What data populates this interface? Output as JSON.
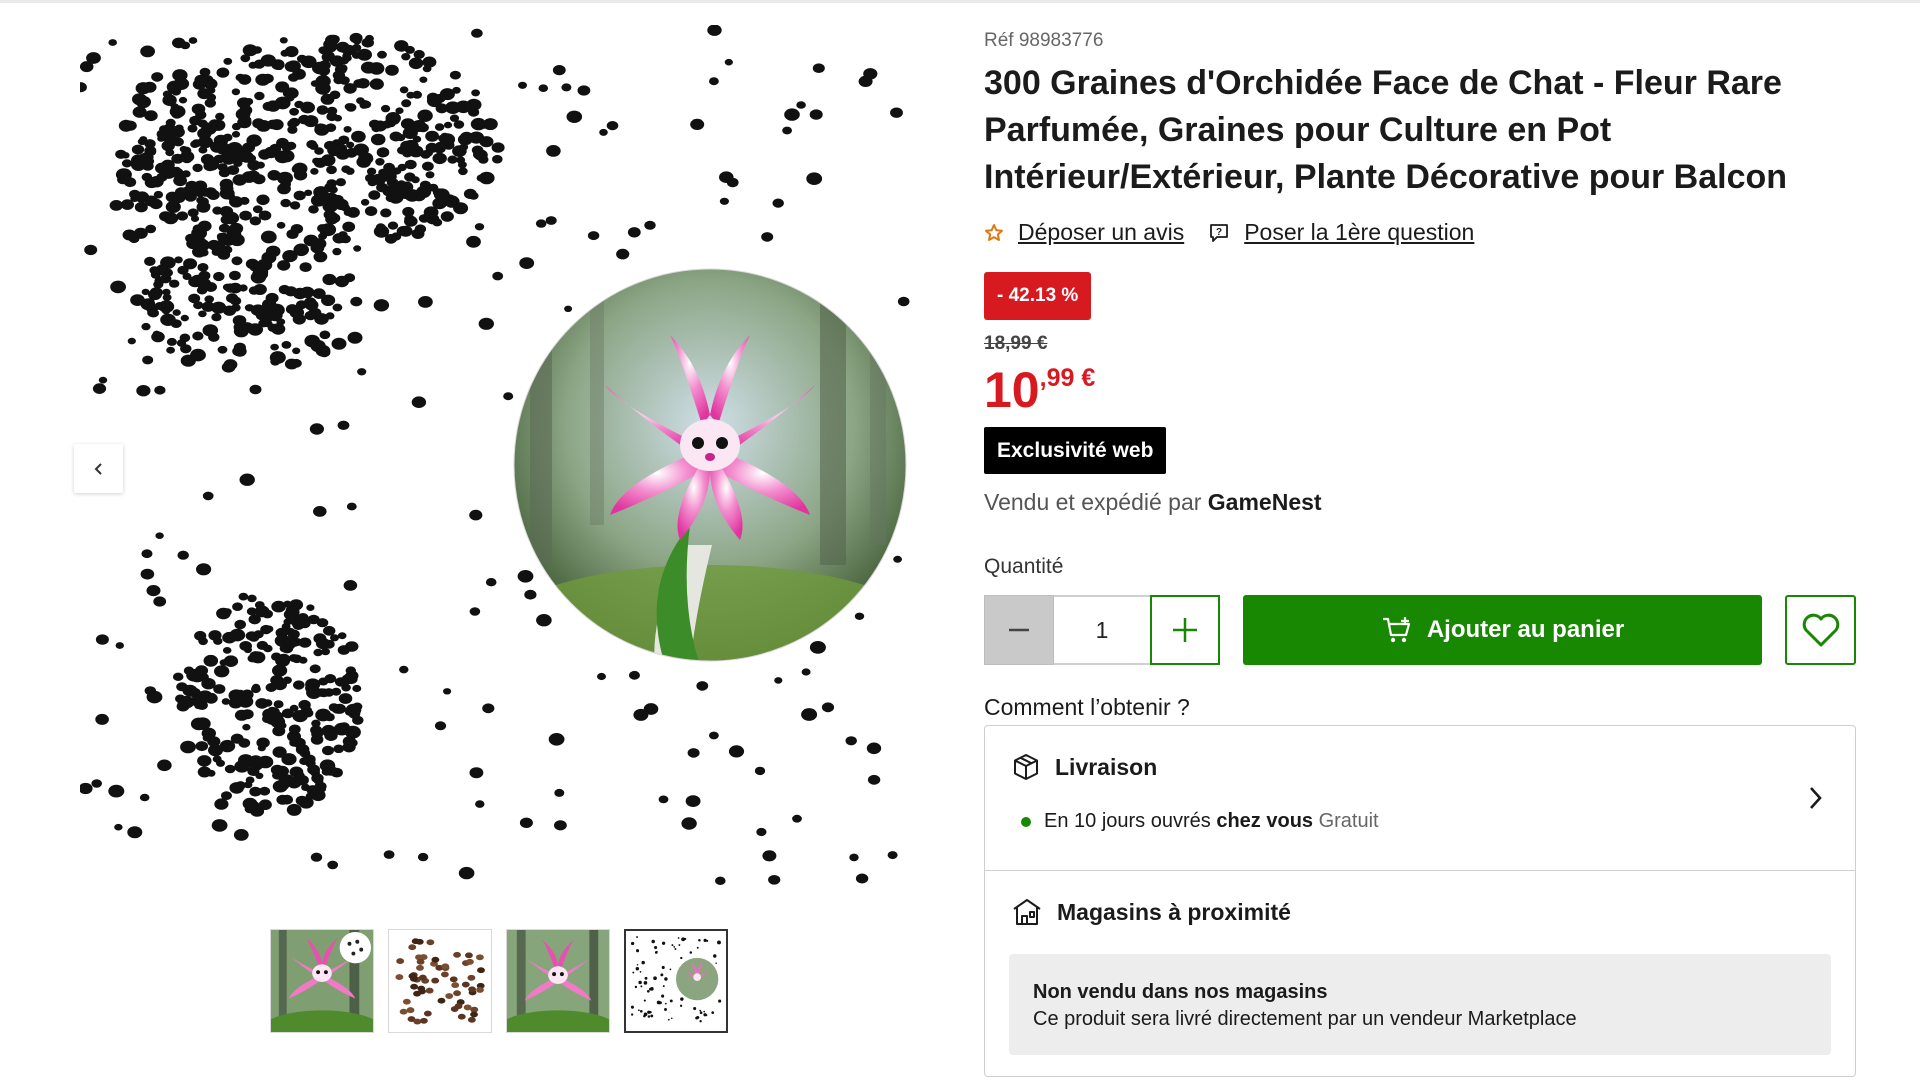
{
  "product": {
    "ref": "Réf 98983776",
    "title": "300 Graines d'Orchidée Face de Chat - Fleur Rare Parfumée, Graines pour Culture en Pot Intérieur/Extérieur, Plante Décorative pour Balcon",
    "review_link": "Déposer un avis",
    "question_link": "Poser la 1ère question",
    "discount_badge": "- 42.13 %",
    "old_price": "18,99 €",
    "price_int": "10",
    "price_dec": ",99 €",
    "exclusive_badge": "Exclusivité web",
    "seller_prefix": "Vendu et expédié par",
    "seller_name": "GameNest"
  },
  "purchase": {
    "quantity_label": "Quantité",
    "quantity_value": "1",
    "add_to_cart": "Ajouter au panier"
  },
  "availability": {
    "heading": "Comment l’obtenir ?",
    "delivery_title": "Livraison",
    "delivery_delay": "En 10 jours ouvrés",
    "delivery_where": "chez vous",
    "delivery_cost": "Gratuit",
    "stores_title": "Magasins à proximité",
    "stores_note_title": "Non vendu dans nos magasins",
    "stores_note_text": "Ce produit sera livré directement par un vendeur Marketplace"
  },
  "gallery": {
    "thumbnails": [
      "orchid-flower",
      "seeds-pile",
      "orchid-flower",
      "seeds-with-inset"
    ],
    "active_thumbnail": 4
  },
  "colors": {
    "accent_green": "#188803",
    "price_red": "#d71920",
    "badge_black": "#000000",
    "star_orange": "#e07a10"
  }
}
